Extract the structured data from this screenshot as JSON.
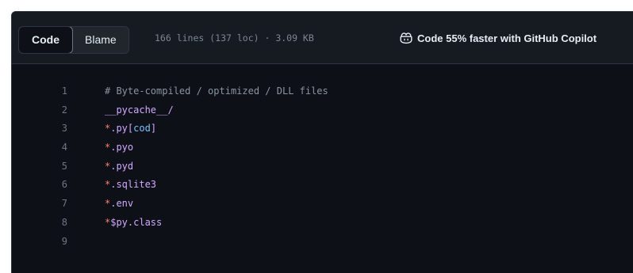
{
  "toolbar": {
    "code_tab": "Code",
    "blame_tab": "Blame",
    "file_meta": "166 lines (137 loc) · 3.09 KB",
    "copilot_label": "Code 55% faster with GitHub Copilot"
  },
  "colors": {
    "background": "#0d1117",
    "toolbar_bg": "#161b22",
    "comment": "#8b949e",
    "symbol": "#ff7b72",
    "name": "#d2a8ff",
    "bracket_content": "#79c0ff"
  },
  "icons": {
    "copilot": "copilot-icon"
  },
  "lines": [
    {
      "number": "1",
      "tokens": [
        {
          "text": "# Byte-compiled / optimized / DLL files",
          "kind": "comment"
        }
      ]
    },
    {
      "number": "2",
      "tokens": [
        {
          "text": "__pycache__/",
          "kind": "name"
        }
      ]
    },
    {
      "number": "3",
      "tokens": [
        {
          "text": "*",
          "kind": "sym"
        },
        {
          "text": ".py[",
          "kind": "name"
        },
        {
          "text": "cod",
          "kind": "blue"
        },
        {
          "text": "]",
          "kind": "name"
        }
      ]
    },
    {
      "number": "4",
      "tokens": [
        {
          "text": "*",
          "kind": "sym"
        },
        {
          "text": ".pyo",
          "kind": "name"
        }
      ]
    },
    {
      "number": "5",
      "tokens": [
        {
          "text": "*",
          "kind": "sym"
        },
        {
          "text": ".pyd",
          "kind": "name"
        }
      ]
    },
    {
      "number": "6",
      "tokens": [
        {
          "text": "*",
          "kind": "sym"
        },
        {
          "text": ".sqlite3",
          "kind": "name"
        }
      ]
    },
    {
      "number": "7",
      "tokens": [
        {
          "text": "*",
          "kind": "sym"
        },
        {
          "text": ".env",
          "kind": "name"
        }
      ]
    },
    {
      "number": "8",
      "tokens": [
        {
          "text": "*",
          "kind": "sym"
        },
        {
          "text": "$py.class",
          "kind": "name"
        }
      ]
    },
    {
      "number": "9",
      "tokens": []
    }
  ]
}
